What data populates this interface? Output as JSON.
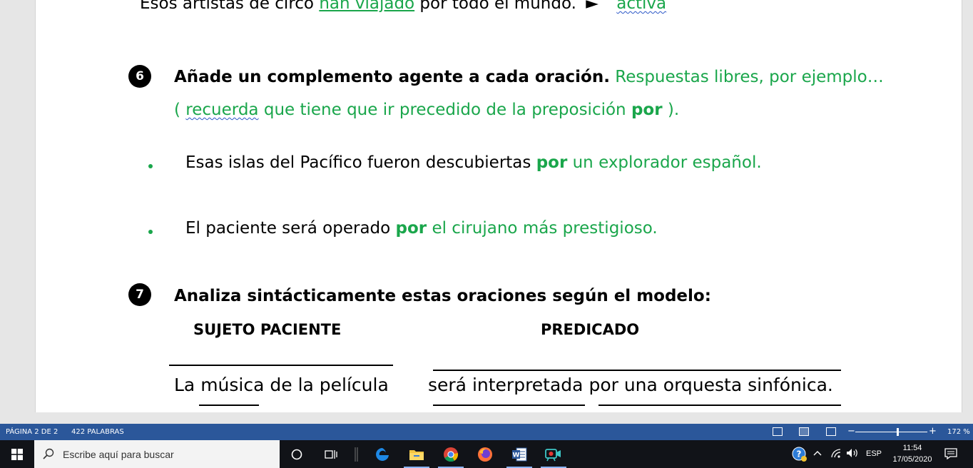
{
  "document": {
    "prev_line": {
      "text_before": "Esos artistas de circo ",
      "highlight": "han viajado",
      "text_after": " por todo el mundo.",
      "arrow": "►",
      "answer": "activa"
    },
    "exercise6": {
      "number": "6",
      "title": "Añade un complemento agente a cada oración.",
      "hint": " Respuestas libres, por ejemplo…",
      "note_open": "( ",
      "note_word": "recuerda",
      "note_mid": " que tiene que ir precedido de la preposición ",
      "note_bold": "por",
      "note_close": " ).",
      "items": [
        {
          "text": "Esas islas del Pacífico fueron descubiertas  ",
          "agent_prep": "por",
          "agent_rest": " un explorador español."
        },
        {
          "text": "El paciente será operado ",
          "agent_prep": "por",
          "agent_rest": " el cirujano más prestigioso."
        }
      ]
    },
    "exercise7": {
      "number": "7",
      "title": "Analiza sintácticamente estas oraciones según el modelo:",
      "label_subject": "SUJETO PACIENTE",
      "label_predicate": "PREDICADO",
      "subject_text": "La música de la película",
      "predicate_verb": "será interpretada",
      "predicate_agent": " por una orquesta sinfónica."
    }
  },
  "statusbar": {
    "page": "PÁGINA 2 DE 2",
    "words": "422 PALABRAS",
    "zoom_minus": "−",
    "zoom_plus": "+",
    "zoom_level": "172 %"
  },
  "taskbar": {
    "search_placeholder": "Escribe aquí para buscar",
    "language": "ESP",
    "time": "11:54",
    "date": "17/05/2020"
  },
  "colors": {
    "answer_green": "#1aa64b",
    "statusbar_blue": "#2b579a",
    "taskbar_bg": "#111318"
  }
}
